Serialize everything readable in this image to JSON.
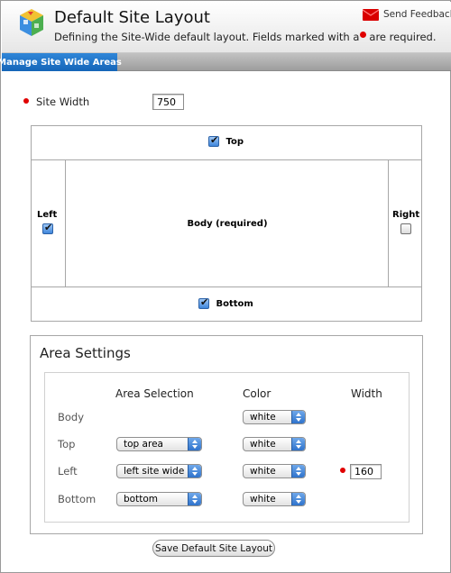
{
  "header": {
    "title": "Default Site Layout",
    "subtitle_before": "Defining the Site-Wide default layout. Fields marked with a",
    "subtitle_after": "are required.",
    "feedback_label": "Send Feedback"
  },
  "tabs": [
    {
      "label": "Manage Site Wide Areas",
      "active": true
    }
  ],
  "site_width": {
    "label": "Site Width",
    "value": "750",
    "required": true
  },
  "layout_regions": {
    "top": {
      "label": "Top",
      "checked": true
    },
    "left": {
      "label": "Left",
      "checked": true
    },
    "body": {
      "label": "Body (required)"
    },
    "right": {
      "label": "Right",
      "checked": false
    },
    "bottom": {
      "label": "Bottom",
      "checked": true
    }
  },
  "area_settings": {
    "title": "Area Settings",
    "columns": {
      "selection": "Area Selection",
      "color": "Color",
      "width": "Width"
    },
    "rows": [
      {
        "label": "Body",
        "selection": "",
        "color": "white",
        "width": ""
      },
      {
        "label": "Top",
        "selection": "top area",
        "color": "white",
        "width": ""
      },
      {
        "label": "Left",
        "selection": "left site wide",
        "color": "white",
        "width": "160",
        "width_required": true
      },
      {
        "label": "Bottom",
        "selection": "bottom",
        "color": "white",
        "width": ""
      }
    ]
  },
  "save_button_label": "Save Default Site Layout",
  "colors": {
    "accent": "#1f72c8",
    "required": "#e00000",
    "border": "#a7a7a7"
  }
}
